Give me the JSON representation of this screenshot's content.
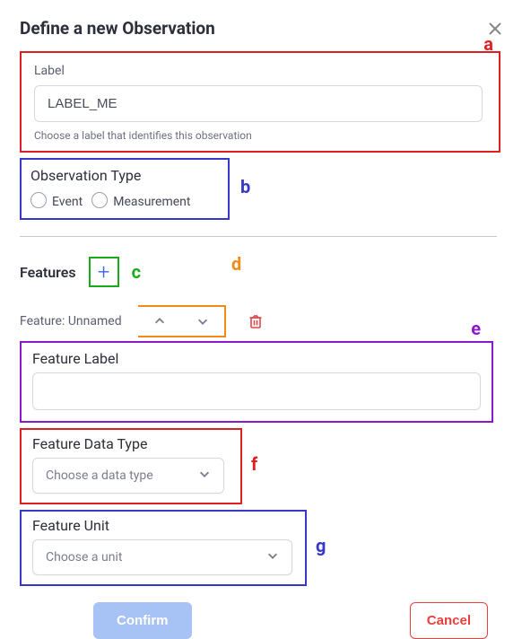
{
  "dialog": {
    "title": "Define a new Observation",
    "section_a": {
      "field_label": "Label",
      "value": "LABEL_ME",
      "help": "Choose a label that identifies this observation"
    },
    "section_b": {
      "field_label": "Observation Type",
      "options": {
        "event": "Event",
        "measurement": "Measurement"
      }
    },
    "features_title": "Features",
    "feature_head_prefix": "Feature: ",
    "feature_head_name": "Unnamed",
    "section_e": {
      "field_label": "Feature Label",
      "value": ""
    },
    "section_f": {
      "field_label": "Feature Data Type",
      "placeholder": "Choose a data type"
    },
    "section_g": {
      "field_label": "Feature Unit",
      "placeholder": "Choose a unit"
    },
    "buttons": {
      "confirm": "Confirm",
      "cancel": "Cancel"
    }
  },
  "annotations": {
    "a": "a",
    "b": "b",
    "c": "c",
    "d": "d",
    "e": "e",
    "f": "f",
    "g": "g"
  },
  "colors": {
    "annotation_red": "#e02020",
    "annotation_blue": "#3737c8",
    "annotation_green": "#1aab1a",
    "annotation_orange": "#f28a1a",
    "annotation_purple": "#8a1acb"
  }
}
